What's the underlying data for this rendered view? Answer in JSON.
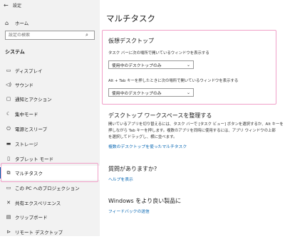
{
  "window": {
    "title": "設定"
  },
  "sidebar": {
    "home_label": "ホーム",
    "search_placeholder": "設定の検索",
    "category": "システム",
    "items": [
      {
        "label": "ディスプレイ",
        "icon": "display-icon"
      },
      {
        "label": "サウンド",
        "icon": "speaker-icon"
      },
      {
        "label": "通知とアクション",
        "icon": "notification-icon"
      },
      {
        "label": "集中モード",
        "icon": "moon-icon"
      },
      {
        "label": "電源とスリープ",
        "icon": "power-icon"
      },
      {
        "label": "ストレージ",
        "icon": "storage-icon"
      },
      {
        "label": "タブレット モード",
        "icon": "tablet-icon"
      },
      {
        "label": "マルチタスク",
        "icon": "multitask-icon",
        "selected": true
      },
      {
        "label": "この PC へのプロジェクション",
        "icon": "projection-icon"
      },
      {
        "label": "共有エクスペリエンス",
        "icon": "share-icon"
      },
      {
        "label": "クリップボード",
        "icon": "clipboard-icon"
      },
      {
        "label": "リモート デスクトップ",
        "icon": "remote-desktop-icon"
      }
    ]
  },
  "main": {
    "title": "マルチタスク",
    "virtual_desktop": {
      "title": "仮想デスクトップ",
      "taskbar_label": "タスク バーに次の場所で開いているウィンドウを表示する",
      "taskbar_value": "使用中のデスクトップのみ",
      "alttab_label": "Alt + Tab キーを押したときに次の場所で開いているウィンドウを表示する",
      "alttab_value": "使用中のデスクトップのみ"
    },
    "organize": {
      "title": "デスクトップ ワークスペースを整理する",
      "line1": "開いているアプリを切り替えるには、タスク バーで [タスク ビュー] ボタンを選択するか、Alt キーを",
      "line2": "押しながら Tab キーを押します。複数のアプリを同時に使用するには、アプリ ウィンドウの上部",
      "line3": "を選択してドラッグし、横に並べます。",
      "link": "複数のデスクトップを使ったマルチタスク"
    },
    "question": {
      "title": "質問がありますか?",
      "link": "ヘルプを表示"
    },
    "feedback": {
      "title": "Windows をより良い製品に",
      "link": "フィードバックの送信"
    }
  },
  "colors": {
    "accent": "#0063b1",
    "highlight_box": "#f0a0c8",
    "sidebar_bg": "#f2f2f2"
  }
}
